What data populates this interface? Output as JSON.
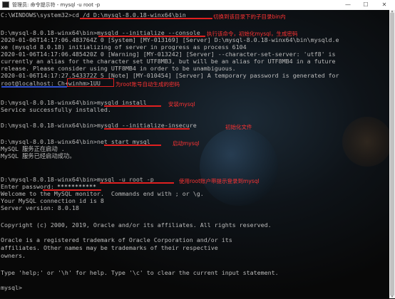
{
  "window": {
    "title": "管理员: 命令提示符 - mysql -u root -p",
    "minimize": "—",
    "maximize": "☐",
    "close": "✕"
  },
  "terminal": {
    "lines": [
      "C:\\WINDOWS\\system32>cd /d D:\\mysql-8.0.18-winx64\\bin",
      "",
      "D:\\mysql-8.0.18-winx64\\bin>mysqld --initialize --console",
      "2020-01-06T14:17:06.483764Z 0 [System] [MY-013169] [Server] D:\\mysql-8.0.18-winx64\\bin\\mysqld.e",
      "xe (mysqld 8.0.18) initializing of server in progress as process 6104",
      "2020-01-06T14:17:06.485420Z 0 [Warning] [MY-013242] [Server] --character-set-server: 'utf8' is",
      "currently an alias for the character set UTF8MB3, but will be an alias for UTF8MB4 in a future",
      "release. Please consider using UTF8MB4 in order to be unambiguous.",
      "2020-01-06T14:17:27.543372Z 5 [Note] [MY-010454] [Server] A temporary password is generated for",
      "root@localhost: Ch+winhm>1UU",
      "",
      "D:\\mysql-8.0.18-winx64\\bin>mysqld install",
      "Service successfully installed.",
      "",
      "D:\\mysql-8.0.18-winx64\\bin>mysqld --initialize-insecure",
      "",
      "D:\\mysql-8.0.18-winx64\\bin>net start mysql",
      "MySQL 服务正在启动 .",
      "MySQL 服务已经启动成功。",
      "",
      "",
      "D:\\mysql-8.0.18-winx64\\bin>mysql -u root -p",
      "Enter password: ",
      "Welcome to the MySQL monitor.  Commands end with ; or \\g.",
      "Your MySQL connection id is 8",
      "Server version: 8.0.18",
      "",
      "Copyright (c) 2000, 2019, Oracle and/or its affiliates. All rights reserved.",
      "",
      "Oracle is a registered trademark of Oracle Corporation and/or its",
      "affiliates. Other names may be trademarks of their respective",
      "owners.",
      "",
      "Type 'help;' or '\\h' for help. Type '\\c' to clear the current input statement.",
      "",
      "mysql>"
    ],
    "password_mask": "***********"
  },
  "annotations": {
    "cd": "切换到该目录下的子目录bin内",
    "initialize": "执行该命令，初始化mysql，生成密码",
    "password": "为root账号自动生成的密码",
    "install": "安装mysql",
    "insecure": "初始化文件",
    "start": "启动mysql",
    "login": "使用root账户带提示登录到mysql"
  },
  "colors": {
    "annotation": "#ff3333",
    "underline": "#e02020",
    "text": "#bcbcbc"
  }
}
